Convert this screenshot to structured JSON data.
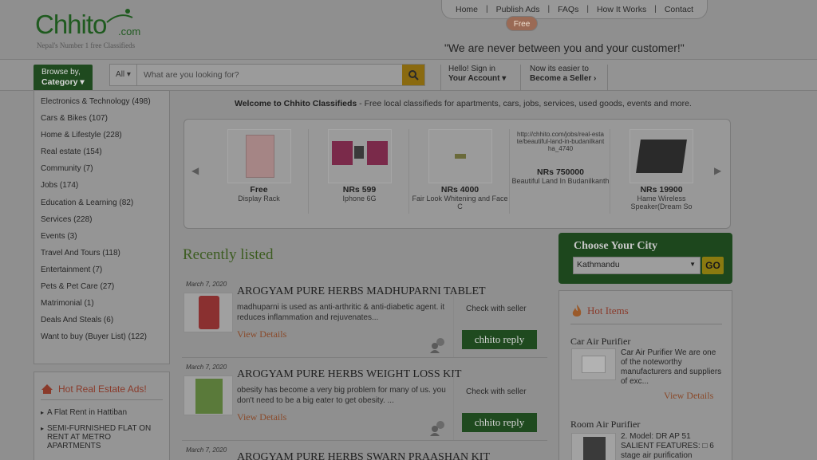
{
  "logo": {
    "brand": "Chhito",
    "suffix": ".com",
    "tagline": "Nepal's Number 1 free Classifieds"
  },
  "topnav": {
    "items": [
      "Home",
      "Publish Ads",
      "FAQs",
      "How It Works",
      "Contact"
    ],
    "free_badge": "Free"
  },
  "tagline": "\"We are never between you and your customer!\"",
  "browse": {
    "line1": "Browse by,",
    "line2": "Category"
  },
  "search": {
    "scope": "All",
    "placeholder": "What are you looking for?"
  },
  "account": {
    "line1": "Hello! Sign in",
    "line2": "Your Account"
  },
  "seller": {
    "line1": "Now its easier to",
    "line2": "Become a Seller"
  },
  "categories": [
    "Electronics & Technology (498)",
    "Cars & Bikes (107)",
    "Home & Lifestyle (228)",
    "Real estate (154)",
    "Community (7)",
    "Jobs (174)",
    "Education & Learning (82)",
    "Services (228)",
    "Events (3)",
    "Travel And Tours (118)",
    "Entertainment (7)",
    "Pets & Pet Care (27)",
    "Matrimonial (1)",
    "Deals And Steals (6)",
    "Want to buy (Buyer List) (122)"
  ],
  "hot_real_estate": {
    "heading": "Hot Real Estate Ads!",
    "items": [
      "A Flat Rent in Hattiban",
      "SEMI-FURNISHED FLAT ON RENT AT METRO APARTMENTS"
    ]
  },
  "welcome": {
    "bold": "Welcome to Chhito Classifieds",
    "rest": " - Free local classifieds for apartments, cars, jobs, services, used goods, events and more."
  },
  "carousel": [
    {
      "price": "Free",
      "name": "Display Rack"
    },
    {
      "price": "NRs 599",
      "name": "Iphone 6G"
    },
    {
      "price": "NRs 4000",
      "name": "Fair Look Whitening and Face C"
    },
    {
      "alt": "http://chhito.com/jobs/real-estate/beautiful-land-in-budanilkantha_4740",
      "price": "NRs 750000",
      "name": "Beautiful Land In Budanilkanth"
    },
    {
      "price": "NRs 19900",
      "name": "Hame Wireless Speaker(Dream So"
    }
  ],
  "recent": {
    "heading": "Recently listed",
    "items": [
      {
        "date": "March 7, 2020",
        "title": "AROGYAM PURE HERBS MADHUPARNI TABLET",
        "desc": "madhuparni is used as anti-arthritic & anti-diabetic agent. it reduces inflammation and rejuvenates...",
        "view": "View Details",
        "check": "Check with seller",
        "reply": "chhito reply"
      },
      {
        "date": "March 7, 2020",
        "title": "AROGYAM PURE HERBS WEIGHT LOSS KIT",
        "desc": "obesity has become a very big problem for many of us. you don't need to be a big eater to get obesity. ...",
        "view": "View Details",
        "check": "Check with seller",
        "reply": "chhito reply"
      },
      {
        "date": "March 7, 2020",
        "title": "AROGYAM PURE HERBS SWARN PRAASHAN KIT"
      }
    ]
  },
  "city": {
    "heading": "Choose Your City",
    "selected": "Kathmandu",
    "go": "GO"
  },
  "hot_items": {
    "heading": "Hot Items",
    "items": [
      {
        "title": "Car Air Purifier",
        "desc": "Car Air Purifier We are one of the noteworthy manufacturers and suppliers of exc...",
        "view": "View Details"
      },
      {
        "title": "Room Air Purifier",
        "desc": "2. Model: DR AP 51 SALIENT FEATURES: □ 6 stage air purification"
      }
    ]
  },
  "colors": {
    "brand_green": "#1f4a1f",
    "accent_brown": "#8a3a2a",
    "title_green": "#3c5c20"
  }
}
